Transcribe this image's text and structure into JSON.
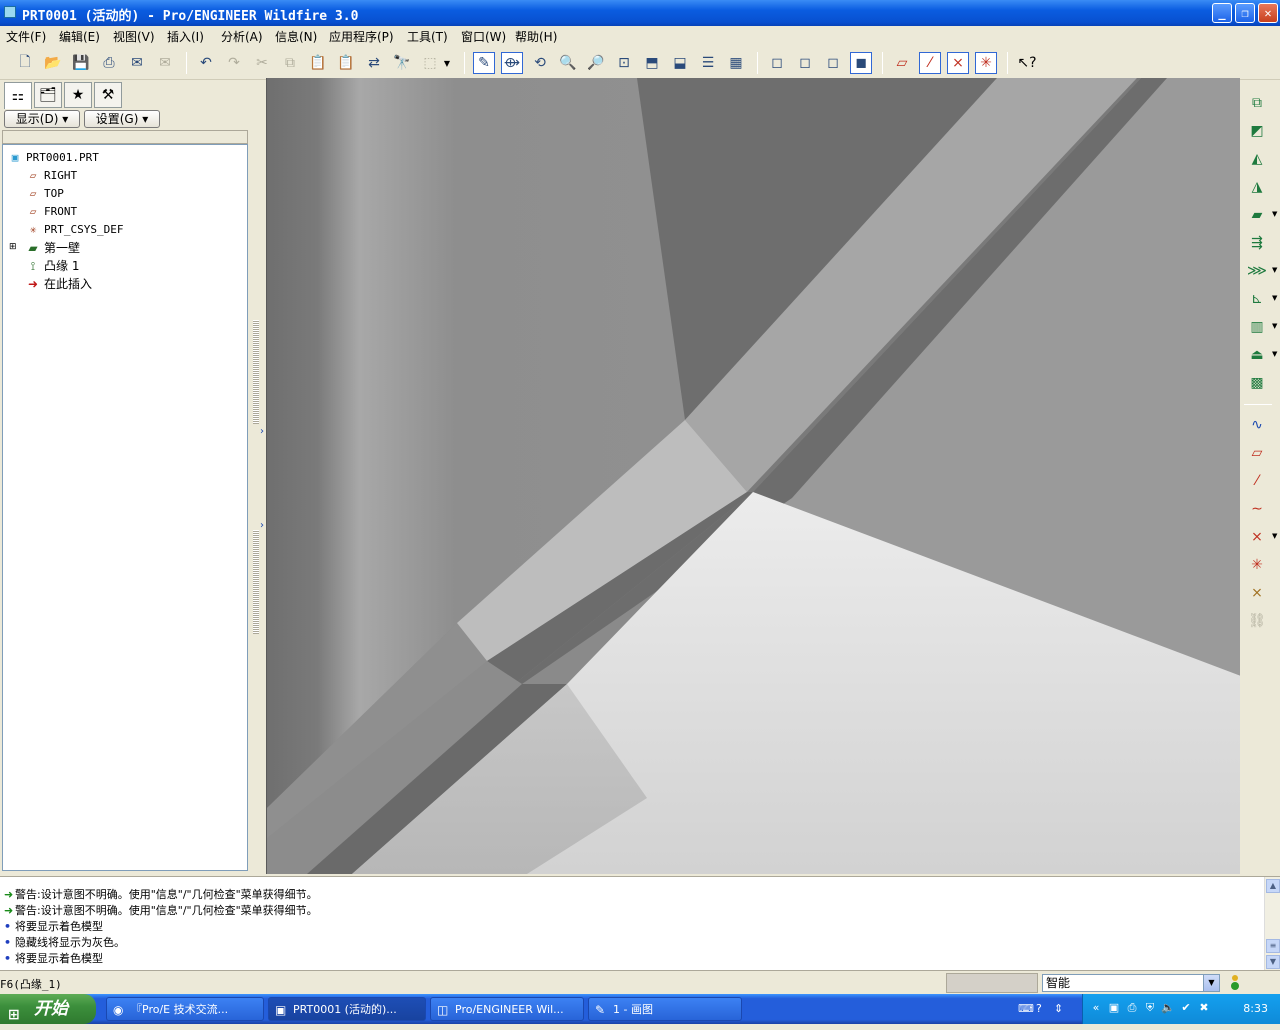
{
  "window": {
    "title": "PRT0001 (活动的) - Pro/ENGINEER Wildfire 3.0",
    "minimize": "_",
    "maximize": "❐",
    "close": "✕"
  },
  "menu": [
    "文件(F)",
    "编辑(E)",
    "视图(V)",
    "插入(I)",
    "分析(A)",
    "信息(N)",
    "应用程序(P)",
    "工具(T)",
    "窗口(W)",
    "帮助(H)"
  ],
  "navigator": {
    "show_button": "显示(D)",
    "settings_button": "设置(G)",
    "tree": [
      {
        "label": "PRT0001.PRT",
        "icon": "part-icon"
      },
      {
        "label": "RIGHT",
        "icon": "datum-plane-icon"
      },
      {
        "label": "TOP",
        "icon": "datum-plane-icon"
      },
      {
        "label": "FRONT",
        "icon": "datum-plane-icon"
      },
      {
        "label": "PRT_CSYS_DEF",
        "icon": "csys-icon"
      },
      {
        "label": "第一壁",
        "icon": "sheetmetal-wall-icon"
      },
      {
        "label": "凸缘 1",
        "icon": "flange-icon"
      },
      {
        "label": "在此插入",
        "icon": "insert-here-arrow-icon"
      }
    ]
  },
  "messages": [
    {
      "type": "warning",
      "text": "警告:设计意图不明确。使用\"信息\"/\"几何检查\"菜单获得细节。"
    },
    {
      "type": "warning",
      "text": "警告:设计意图不明确。使用\"信息\"/\"几何检查\"菜单获得细节。"
    },
    {
      "type": "info",
      "text": "将要显示着色模型"
    },
    {
      "type": "info",
      "text": "隐藏线将显示为灰色。"
    },
    {
      "type": "info",
      "text": "将要显示着色模型"
    }
  ],
  "status": {
    "text": "F6(凸缘_1)",
    "filter": "智能"
  },
  "taskbar": {
    "start": "开始",
    "tasks": [
      {
        "label": "『Pro/E 技术交流...",
        "icon": "firefox-icon"
      },
      {
        "label": "PRT0001 (活动的)...",
        "icon": "proe-icon"
      },
      {
        "label": "Pro/ENGINEER Wil...",
        "icon": "proe-window-icon"
      },
      {
        "label": "1 - 画图",
        "icon": "paint-icon"
      }
    ],
    "clock": "8:33"
  },
  "colors": {
    "titlebar": "#0a5ce0",
    "chrome": "#ece9d8",
    "viewport_dark": "#707070",
    "viewport_light": "#e6e6e6",
    "taskbar": "#245edb"
  }
}
